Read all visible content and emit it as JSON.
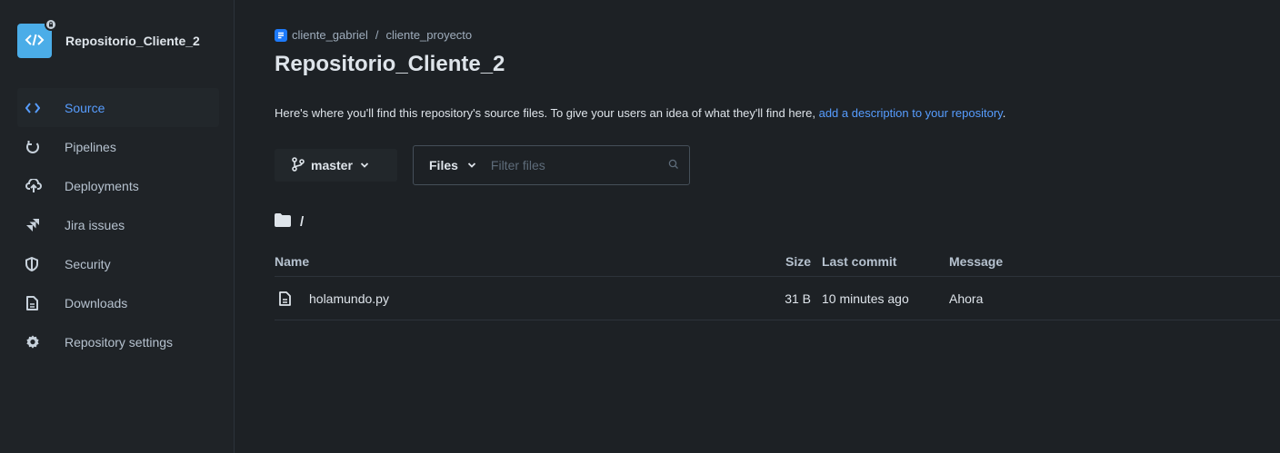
{
  "colors": {
    "background": "#1d2125",
    "sidebar": "#1f2327",
    "accent": "#579dff",
    "repo_avatar": "#4bade8",
    "project_icon": "#1d7afc"
  },
  "sidebar": {
    "repo_name": "Repositorio_Cliente_2",
    "repo_icon": "code-brackets-icon",
    "items": [
      {
        "label": "Source",
        "icon": "code-icon",
        "active": true
      },
      {
        "label": "Pipelines",
        "icon": "pipelines-icon",
        "active": false
      },
      {
        "label": "Deployments",
        "icon": "cloud-upload-icon",
        "active": false
      },
      {
        "label": "Jira issues",
        "icon": "jira-icon",
        "active": false
      },
      {
        "label": "Security",
        "icon": "shield-icon",
        "active": false
      },
      {
        "label": "Downloads",
        "icon": "file-icon",
        "active": false
      },
      {
        "label": "Repository settings",
        "icon": "gear-icon",
        "active": false
      }
    ]
  },
  "header": {
    "breadcrumb": {
      "workspace": "cliente_gabriel",
      "separator": "/",
      "project": "cliente_proyecto"
    },
    "title": "Repositorio_Cliente_2",
    "description_text": "Here's where you'll find this repository's source files. To give your users an idea of what they'll find here, ",
    "description_link": "add a description to your repository",
    "description_end": "."
  },
  "toolbar": {
    "branch": "master",
    "files_label": "Files",
    "filter_placeholder": "Filter files"
  },
  "path": "/",
  "table": {
    "columns": [
      "Name",
      "Size",
      "Last commit",
      "Message"
    ],
    "rows": [
      {
        "name": "holamundo.py",
        "size": "31 B",
        "last_commit": "10 minutes ago",
        "message": "Ahora",
        "icon": "file-icon"
      }
    ]
  }
}
